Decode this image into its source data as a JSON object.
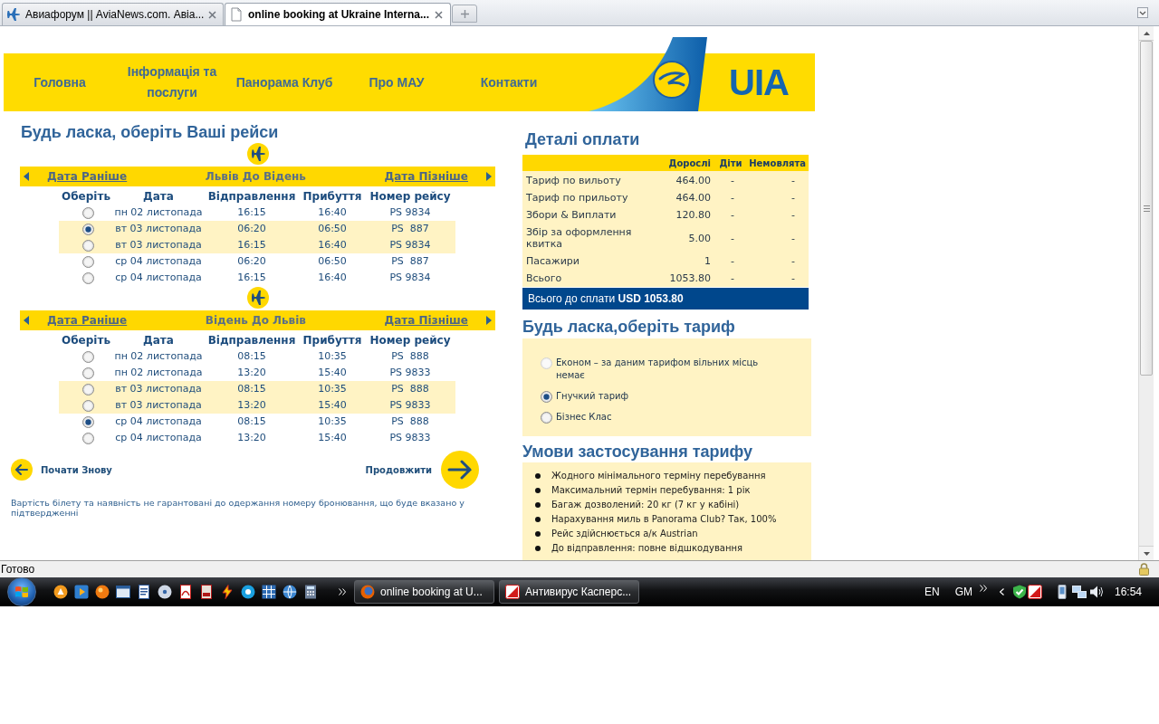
{
  "browser": {
    "tabs": [
      {
        "title": "Авиафорум || AviaNews.com. Авіа...",
        "selected": false
      },
      {
        "title": "online booking at Ukraine Interna...",
        "selected": true
      }
    ]
  },
  "header": {
    "nav": [
      "Головна",
      "Інформація та послуги",
      "Панорама Клуб",
      "Про МАУ",
      "Контакти"
    ],
    "logo_text": "UIA"
  },
  "flights": {
    "title": "Будь ласка, оберіть Ваші рейси",
    "segments": [
      {
        "earlier": "Дата Раніше",
        "route": "Львів До Відень",
        "later": "Дата Пізніше",
        "columns": [
          "Оберіть",
          "Дата",
          "Відправлення",
          "Прибуття",
          "Номер рейсу"
        ],
        "rows": [
          {
            "date": "пн 02 листопада",
            "departure": "16:15",
            "arrival": "16:40",
            "flight": "PS 9834",
            "selected": false,
            "highlighted": false
          },
          {
            "date": "вт 03 листопада",
            "departure": "06:20",
            "arrival": "06:50",
            "flight": "PS  887",
            "selected": true,
            "highlighted": true
          },
          {
            "date": "вт 03 листопада",
            "departure": "16:15",
            "arrival": "16:40",
            "flight": "PS 9834",
            "selected": false,
            "highlighted": true
          },
          {
            "date": "ср 04 листопада",
            "departure": "06:20",
            "arrival": "06:50",
            "flight": "PS  887",
            "selected": false,
            "highlighted": false
          },
          {
            "date": "ср 04 листопада",
            "departure": "16:15",
            "arrival": "16:40",
            "flight": "PS 9834",
            "selected": false,
            "highlighted": false
          }
        ]
      },
      {
        "earlier": "Дата Раніше",
        "route": "Відень До Львів",
        "later": "Дата Пізніше",
        "columns": [
          "Оберіть",
          "Дата",
          "Відправлення",
          "Прибуття",
          "Номер рейсу"
        ],
        "rows": [
          {
            "date": "пн 02 листопада",
            "departure": "08:15",
            "arrival": "10:35",
            "flight": "PS  888",
            "selected": false,
            "highlighted": false
          },
          {
            "date": "пн 02 листопада",
            "departure": "13:20",
            "arrival": "15:40",
            "flight": "PS 9833",
            "selected": false,
            "highlighted": false
          },
          {
            "date": "вт 03 листопада",
            "departure": "08:15",
            "arrival": "10:35",
            "flight": "PS  888",
            "selected": false,
            "highlighted": true
          },
          {
            "date": "вт 03 листопада",
            "departure": "13:20",
            "arrival": "15:40",
            "flight": "PS 9833",
            "selected": false,
            "highlighted": true
          },
          {
            "date": "ср 04 листопада",
            "departure": "08:15",
            "arrival": "10:35",
            "flight": "PS  888",
            "selected": true,
            "highlighted": false
          },
          {
            "date": "ср 04 листопада",
            "departure": "13:20",
            "arrival": "15:40",
            "flight": "PS 9833",
            "selected": false,
            "highlighted": false
          }
        ]
      }
    ],
    "restart": "Почати Знову",
    "continue": "Продовжити",
    "disclaimer": "Вартість білету та наявність не гарантовані до одержання номеру бронювання, що буде вказано у підтвердженні"
  },
  "payment": {
    "title": "Деталі оплати",
    "columns": [
      "Дорослі",
      "Діти",
      "Немовлята"
    ],
    "rows": [
      {
        "label": "Тариф по вильоту",
        "adults": "464.00",
        "children": "-",
        "infants": "-"
      },
      {
        "label": "Тариф по прильоту",
        "adults": "464.00",
        "children": "-",
        "infants": "-"
      },
      {
        "label": "Збори & Виплати",
        "adults": "120.80",
        "children": "-",
        "infants": "-"
      },
      {
        "label": "Збір за оформлення квитка",
        "adults": "5.00",
        "children": "-",
        "infants": "-"
      },
      {
        "label": "Пасажири",
        "adults": "1",
        "children": "-",
        "infants": "-"
      },
      {
        "label": "Всього",
        "adults": "1053.80",
        "children": "-",
        "infants": "-"
      }
    ],
    "total": "Всього до сплати **USD 1053.80**"
  },
  "fare": {
    "title": "Будь ласка,оберіть тариф",
    "options": [
      {
        "label": "Економ – за даним тарифом вільних місць немає",
        "selected": false,
        "disabled": true
      },
      {
        "label": "Гнучкий тариф",
        "selected": true,
        "disabled": false
      },
      {
        "label": "Бізнес Клас",
        "selected": false,
        "disabled": false
      }
    ]
  },
  "conditions": {
    "title": "Умови застосування тарифу",
    "items": [
      "Жодного мінімального терміну перебування",
      "Максимальний термін перебування: 1 рік",
      "Багаж дозволений: 20 кг (7 кг у кабіні)",
      "Нарахування миль в Panorama Club? Так, 100%",
      "Рейс здійснюється а/к Austrian",
      "До відправлення: повне відшкодування"
    ]
  },
  "status_bar": {
    "text": "Готово"
  },
  "taskbar": {
    "tasks": [
      {
        "label": "online booking at U..."
      },
      {
        "label": "Антивирус Касперс..."
      }
    ],
    "language": "EN",
    "toolbar_label": "GM",
    "time": "16:54"
  }
}
